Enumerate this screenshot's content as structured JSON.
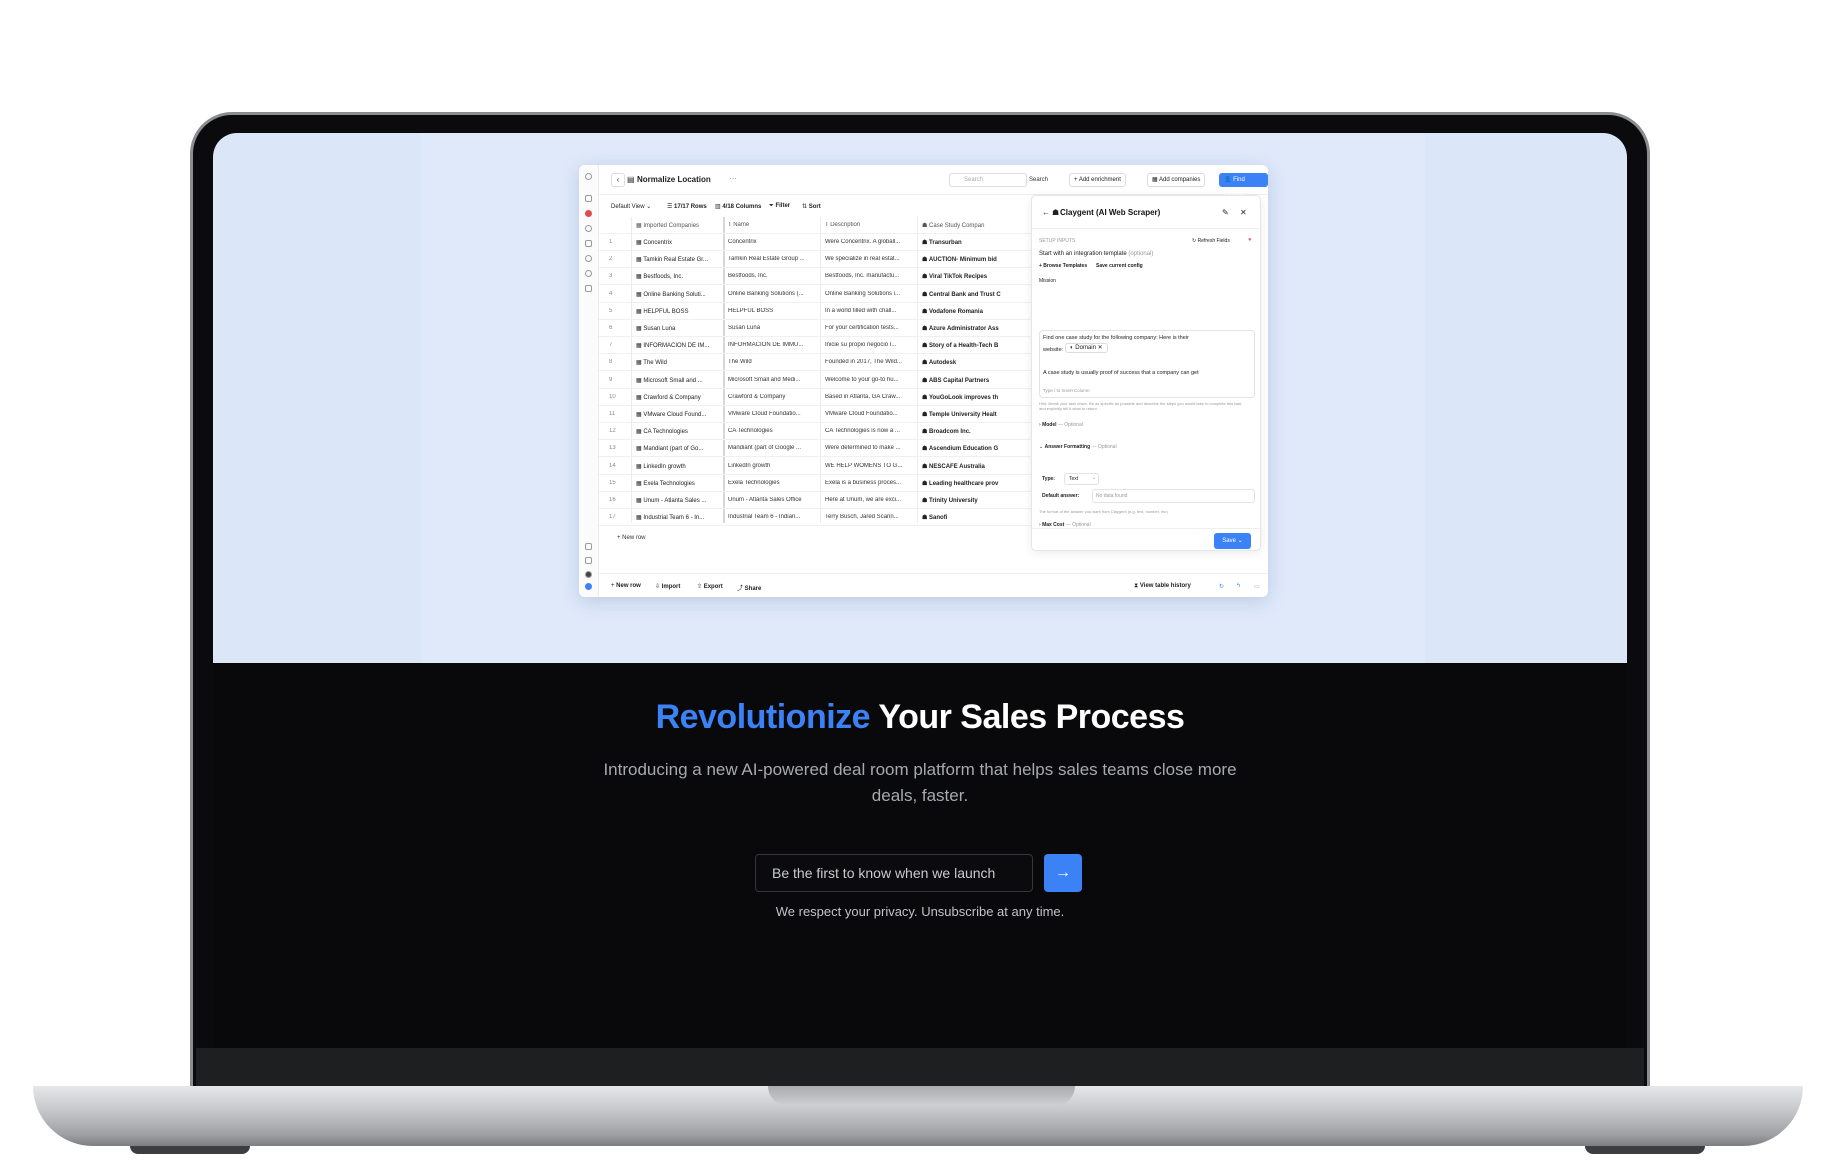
{
  "app": {
    "table_title": "Normalize Location",
    "title_more": "···",
    "search_placeholder": "Search",
    "search_button": "Search",
    "add_enrichment": "Add enrichment",
    "add_companies": "Add companies",
    "find_people": "Find People",
    "toolbar": {
      "view": "Default View",
      "rows": "17/17 Rows",
      "columns": "4/18 Columns",
      "filter": "Filter",
      "sort": "Sort"
    },
    "columns": [
      "Imported Companies",
      "Name",
      "Description",
      "Case Study Compan"
    ],
    "rows": [
      {
        "num": "1",
        "imported": "Concentrix",
        "name": "Concentrix",
        "description": "Were Concentrix. A globall...",
        "case_study": "Transurban"
      },
      {
        "num": "2",
        "imported": "Tamkin Real Estate Gr...",
        "name": "Tamkin Real Estate Group ...",
        "description": "We specialize in real estat...",
        "case_study": "AUCTION- Minimum bid"
      },
      {
        "num": "3",
        "imported": "Bestfoods, Inc.",
        "name": "Bestfoods, Inc.",
        "description": "Bestfoods, Inc. manufactu...",
        "case_study": "Viral TikTok Recipes"
      },
      {
        "num": "4",
        "imported": "Online Banking Soluti...",
        "name": "Online Banking Solutions (...",
        "description": "Online Banking Solutions i...",
        "case_study": "Central Bank and Trust C"
      },
      {
        "num": "5",
        "imported": "HELPFUL BOSS",
        "name": "HELPFUL BOSS",
        "description": "In a world filled with chall...",
        "case_study": "Vodafone Romania"
      },
      {
        "num": "6",
        "imported": "Susan Luna",
        "name": "Susan Luna",
        "description": "For your certification tests...",
        "case_study": "Azure Administrator Ass"
      },
      {
        "num": "7",
        "imported": "INFORMACION DE IM...",
        "name": "INFORMACION DE IMMU...",
        "description": "Inicie su propio negocio I...",
        "case_study": "Story of a Health-Tech B"
      },
      {
        "num": "8",
        "imported": "The Wild",
        "name": "The Wild",
        "description": "Founded in 2017, The Wild...",
        "case_study": "Autodesk"
      },
      {
        "num": "9",
        "imported": "Microsoft Small and ...",
        "name": "Microsoft Small and Medi...",
        "description": "Welcome to your go-to hu...",
        "case_study": "ABS Capital Partners"
      },
      {
        "num": "10",
        "imported": "Crawford & Company",
        "name": "Crawford & Company",
        "description": "Based in Atlanta, GA Craw...",
        "case_study": "YouGoLook improves th"
      },
      {
        "num": "11",
        "imported": "VMware Cloud Found...",
        "name": "VMware Cloud Foundatio...",
        "description": "VMware Cloud Foundatio...",
        "case_study": "Temple University Healt"
      },
      {
        "num": "12",
        "imported": "CA Technologies",
        "name": "CA Technologies",
        "description": "CA Technologies is now a ...",
        "case_study": "Broadcom Inc."
      },
      {
        "num": "13",
        "imported": "Mandiant (part of Go...",
        "name": "Mandiant (part of Google ...",
        "description": "Were determined to make ...",
        "case_study": "Ascendium Education G"
      },
      {
        "num": "14",
        "imported": "LinkedIn growth",
        "name": "LinkedIn growth",
        "description": "WE HELP WOMENS TO G...",
        "case_study": "NESCAFÉ Australia"
      },
      {
        "num": "15",
        "imported": "Exela Technologies",
        "name": "Exela Technologies",
        "description": "Exela is a business proces...",
        "case_study": "Leading healthcare prov"
      },
      {
        "num": "16",
        "imported": "Unum - Atlanta Sales ...",
        "name": "Unum - Atlanta Sales Office",
        "description": "Here at Unum, we are exci...",
        "case_study": "Trinity University"
      },
      {
        "num": "17",
        "imported": "Industrial Team 6 - In...",
        "name": "Industrial Team 6 - Indian...",
        "description": "Terry Busch, Jared Scarin...",
        "case_study": "Sanofi"
      }
    ],
    "new_row_inline": "+ New row",
    "bottom": {
      "new_row": "New row",
      "import": "Import",
      "export": "Export",
      "share": "Share",
      "history": "View table history"
    },
    "panel": {
      "title": "Claygent (AI Web Scraper)",
      "setup_inputs": "SETUP INPUTS",
      "refresh_fields": "Refresh Fields",
      "template_label": "Start with an integration template",
      "template_optional": "(optional)",
      "browse_templates": "+ Browse Templates",
      "save_config": "Save current config",
      "mission_label": "Mission",
      "mission_line1": "Find one case study for the following company: Here is their",
      "mission_line2": "website:",
      "domain_chip": "Domain",
      "mission_line3": "A case study is usually proof of success that a company can get",
      "insert_hint": "Type  /  to Insert Column",
      "hint": "Hint: Break your task down. Be as specific as possible and describe the steps you would take to complete this task and explicitly tell it what to return.",
      "model": "Model",
      "model_optional": "— Optional",
      "answer_formatting": "Answer Formatting",
      "answer_optional": "— Optional",
      "type_label": "Type:",
      "type_value": "Text",
      "default_answer_label": "Default answer:",
      "default_answer_placeholder": "No data found",
      "format_hint": "The format of the answer you want from Claygent (e.g. text, number, etc)",
      "max_cost": "Max Cost",
      "max_cost_optional": "— Optional",
      "save": "Save"
    }
  },
  "hero": {
    "heading_accent": "Revolutionize",
    "heading_rest": " Your Sales Process",
    "subtitle": "Introducing a new AI-powered deal room platform that helps sales teams close more deals, faster.",
    "email_placeholder": "Be the first to know when we launch",
    "submit_icon": "→",
    "privacy": "We respect your privacy. Unsubscribe at any time."
  },
  "colors": {
    "accent": "#3b82f6",
    "hero_bg": "#dbe6f8",
    "dark_bg": "#09090b"
  }
}
